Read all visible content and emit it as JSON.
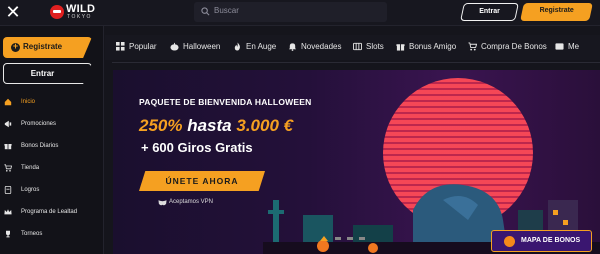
{
  "topbar": {
    "logo_word": "WILD",
    "logo_sub": "TOKYO",
    "search_placeholder": "Buscar",
    "login_label": "Entrar",
    "register_label": "Registrate"
  },
  "sidebar": {
    "register_label": "Registrate",
    "login_label": "Entrar",
    "items": [
      {
        "label": "Inicio",
        "icon": "home-icon",
        "active": true
      },
      {
        "label": "Promociones",
        "icon": "megaphone-icon",
        "active": false
      },
      {
        "label": "Bonos Diarios",
        "icon": "gift-icon",
        "active": false
      },
      {
        "label": "Tienda",
        "icon": "cart-icon",
        "active": false
      },
      {
        "label": "Logros",
        "icon": "badge-icon",
        "active": false
      },
      {
        "label": "Programa de Lealtad",
        "icon": "crown-icon",
        "active": false
      },
      {
        "label": "Torneos",
        "icon": "trophy-icon",
        "active": false
      }
    ]
  },
  "categories": [
    {
      "label": "Popular",
      "icon": "grid-icon"
    },
    {
      "label": "Halloween",
      "icon": "pumpkin-icon"
    },
    {
      "label": "En Auge",
      "icon": "flame-icon"
    },
    {
      "label": "Novedades",
      "icon": "bell-icon"
    },
    {
      "label": "Slots",
      "icon": "slots-icon"
    },
    {
      "label": "Bonus Amigo",
      "icon": "gift-icon"
    },
    {
      "label": "Compra De Bonos",
      "icon": "cart-icon"
    },
    {
      "label": "Me",
      "icon": "more-icon"
    }
  ],
  "banner": {
    "title": "PAQUETE DE BIENVENIDA HALLOWEEN",
    "percent": "250%",
    "hasta": "hasta",
    "amount": "3.000 €",
    "spins": "+ 600 Giros Gratis",
    "cta": "ÚNETE AHORA",
    "vpn": "Aceptamos VPN"
  },
  "mapa_label": "MAPA DE BONOS",
  "colors": {
    "accent": "#f5a021",
    "background": "#15151c",
    "sun": "#ff4a57",
    "mapa_bg": "#3a1670"
  }
}
